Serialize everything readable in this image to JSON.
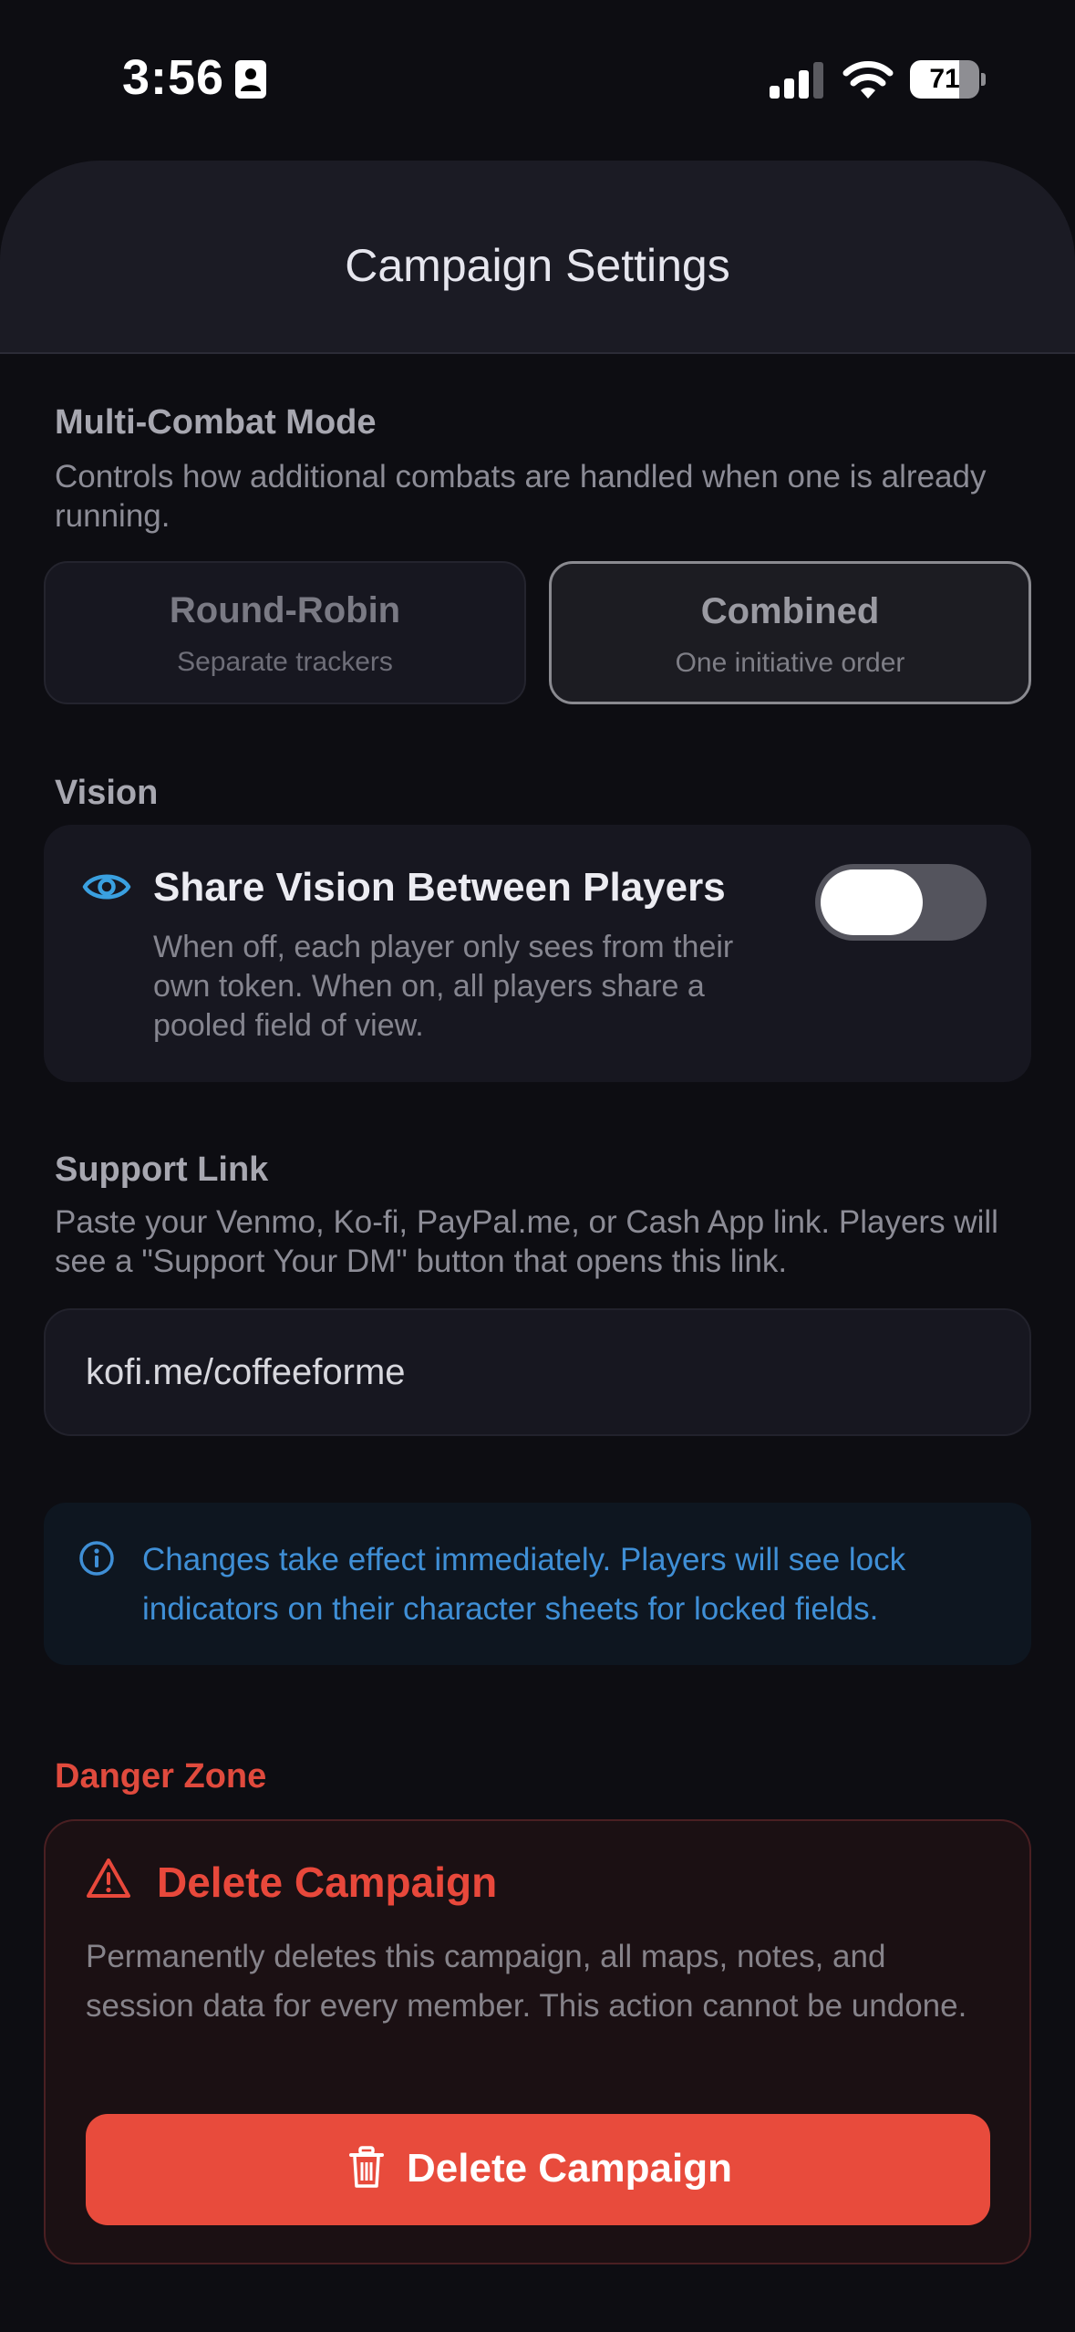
{
  "status_bar": {
    "time": "3:56",
    "battery_level": "71",
    "battery_fraction": 0.71,
    "icons": [
      "id-card-icon",
      "signal-icon",
      "wifi-icon",
      "battery-icon"
    ]
  },
  "header": {
    "title": "Campaign Settings"
  },
  "multi_combat": {
    "label": "Multi-Combat Mode",
    "description": "Controls how additional combats are handled when one is already running.",
    "options": [
      {
        "title": "Round-Robin",
        "subtitle": "Separate trackers",
        "selected": false
      },
      {
        "title": "Combined",
        "subtitle": "One initiative order",
        "selected": true
      }
    ]
  },
  "vision": {
    "label": "Vision",
    "title": "Share Vision Between Players",
    "description": "When off, each player only sees from their own token. When on, all players share a pooled field of view.",
    "enabled": false,
    "icon": "eye-icon"
  },
  "support": {
    "label": "Support Link",
    "description": "Paste your Venmo, Ko-fi, PayPal.me, or Cash App link. Players will see a \"Support Your DM\" button that opens this link.",
    "value": "kofi.me/coffeeforme"
  },
  "info": {
    "icon": "info-icon",
    "text": "Changes take effect immediately. Players will see lock indicators on their character sheets for locked fields."
  },
  "danger": {
    "label": "Danger Zone",
    "title": "Delete Campaign",
    "description": "Permanently deletes this campaign, all maps, notes, and session data for every member. This action cannot be undone.",
    "button_label": "Delete Campaign",
    "icons": [
      "warning-icon",
      "trash-icon"
    ]
  },
  "colors": {
    "background": "#0d0d12",
    "card": "#171720",
    "accent_blue": "#3f8fd6",
    "danger_red": "#e84b3c"
  }
}
